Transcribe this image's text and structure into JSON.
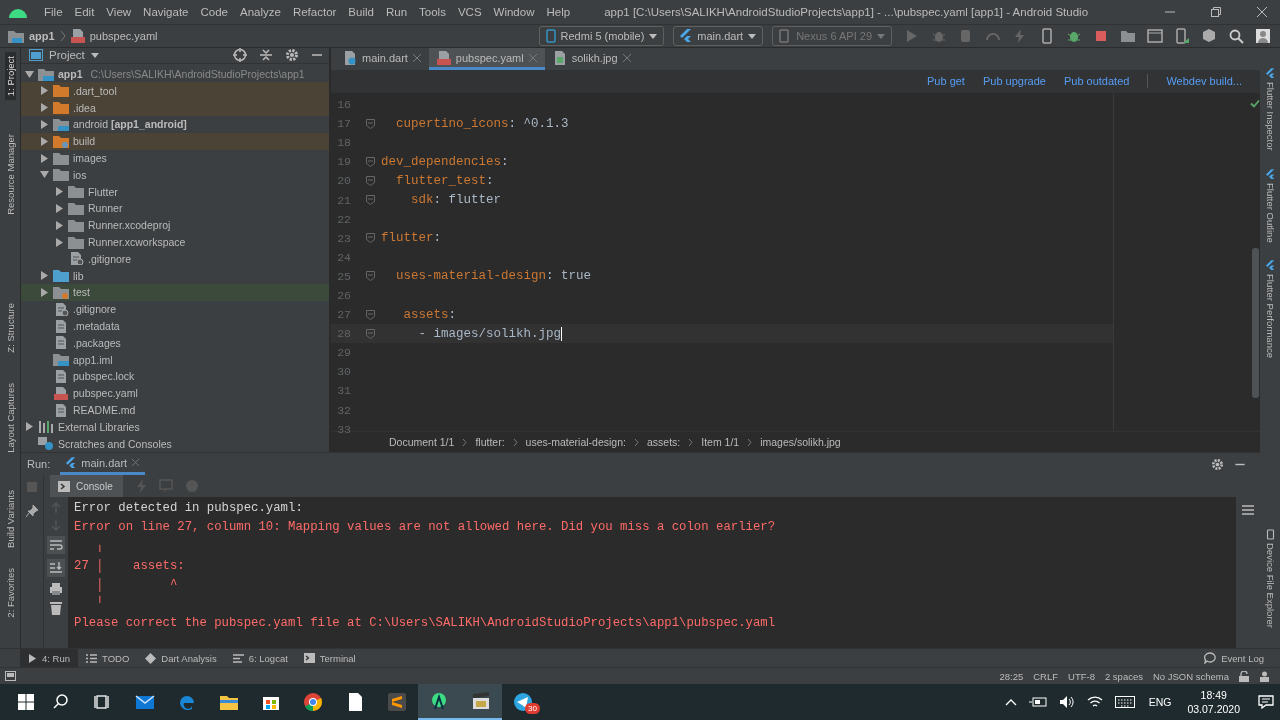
{
  "menu_bar": {
    "items": [
      "File",
      "Edit",
      "View",
      "Navigate",
      "Code",
      "Analyze",
      "Refactor",
      "Build",
      "Run",
      "Tools",
      "VCS",
      "Window",
      "Help"
    ],
    "title": "app1 [C:\\Users\\SALIKH\\AndroidStudioProjects\\app1] - ...\\pubspec.yaml [app1] - Android Studio"
  },
  "nav_bar": {
    "breadcrumb": [
      "app1",
      "pubspec.yaml"
    ],
    "device": "Redmi 5 (mobile)",
    "run_config": "main.dart",
    "emulator": {
      "label": "Nexus 6 API 29",
      "disabled": true
    }
  },
  "left_strip": [
    {
      "label": "1: Project",
      "selected": true
    },
    {
      "label": "Resource Manager",
      "selected": false
    },
    {
      "label": "Z: Structure",
      "selected": false
    },
    {
      "label": "Layout Captures",
      "selected": false
    },
    {
      "label": "Build Variants",
      "selected": false
    },
    {
      "label": "2: Favorites",
      "selected": false
    }
  ],
  "right_strip": [
    "Flutter Inspector",
    "Flutter Outline",
    "Flutter Performance",
    "Device File Explorer"
  ],
  "project": {
    "title": "Project",
    "tree": [
      {
        "name": "app1",
        "path": "C:\\Users\\SALIKH\\AndroidStudioProjects\\app1",
        "kind": "module",
        "expanded": true,
        "children": [
          {
            "name": ".dart_tool",
            "kind": "excluded",
            "expanded": false,
            "color": "#4b4336"
          },
          {
            "name": ".idea",
            "kind": "excluded",
            "expanded": false,
            "color": "#4b4336"
          },
          {
            "name": "android **[app1_android]**",
            "kind": "module",
            "expanded": false
          },
          {
            "name": "build",
            "kind": "build",
            "expanded": false,
            "color": "#4b4336"
          },
          {
            "name": "images",
            "kind": "folder",
            "expanded": false
          },
          {
            "name": "ios",
            "kind": "folder",
            "expanded": true,
            "children": [
              {
                "name": "Flutter",
                "kind": "folder",
                "expanded": false
              },
              {
                "name": "Runner",
                "kind": "folder",
                "expanded": false
              },
              {
                "name": "Runner.xcodeproj",
                "kind": "folder",
                "expanded": false
              },
              {
                "name": "Runner.xcworkspace",
                "kind": "folder",
                "expanded": false
              },
              {
                "name": ".gitignore",
                "kind": "ignore"
              }
            ]
          },
          {
            "name": "lib",
            "kind": "source",
            "expanded": false
          },
          {
            "name": "test",
            "kind": "test",
            "expanded": false,
            "color": "#3c4a3b"
          },
          {
            "name": ".gitignore",
            "kind": "ignore"
          },
          {
            "name": ".metadata",
            "kind": "file"
          },
          {
            "name": ".packages",
            "kind": "file"
          },
          {
            "name": "app1.iml",
            "kind": "module"
          },
          {
            "name": "pubspec.lock",
            "kind": "file"
          },
          {
            "name": "pubspec.yaml",
            "kind": "yaml"
          },
          {
            "name": "README.md",
            "kind": "file"
          }
        ]
      },
      {
        "name": "External Libraries",
        "kind": "libraries",
        "expanded": false
      },
      {
        "name": "Scratches and Consoles",
        "kind": "scratches"
      }
    ]
  },
  "editor": {
    "tabs": [
      {
        "label": "main.dart",
        "kind": "dart",
        "selected": false
      },
      {
        "label": "pubspec.yaml",
        "kind": "yaml",
        "selected": true
      },
      {
        "label": "solikh.jpg",
        "kind": "image",
        "selected": false
      }
    ],
    "actions": [
      "Pub get",
      "Pub upgrade",
      "Pub outdated",
      "Webdev build..."
    ],
    "lines": [
      {
        "number": "16"
      },
      {
        "number": "17",
        "fold": true,
        "current": false,
        "segments": [
          {
            "kind": "key",
            "text": "  cupertino_icons"
          },
          {
            "kind": "plain",
            "text": ": ^0.1.3"
          }
        ]
      },
      {
        "number": "18"
      },
      {
        "number": "19",
        "fold": true,
        "current": false,
        "segments": [
          {
            "kind": "key",
            "text": "dev_dependencies"
          },
          {
            "kind": "plain",
            "text": ":"
          }
        ]
      },
      {
        "number": "20",
        "fold": true,
        "current": false,
        "segments": [
          {
            "kind": "key",
            "text": "  flutter_test"
          },
          {
            "kind": "plain",
            "text": ":"
          }
        ]
      },
      {
        "number": "21",
        "fold": true,
        "current": false,
        "segments": [
          {
            "kind": "key",
            "text": "    sdk"
          },
          {
            "kind": "plain",
            "text": ": flutter"
          }
        ]
      },
      {
        "number": "22"
      },
      {
        "number": "23",
        "fold": true,
        "current": false,
        "segments": [
          {
            "kind": "key",
            "text": "flutter"
          },
          {
            "kind": "plain",
            "text": ":"
          }
        ]
      },
      {
        "number": "24"
      },
      {
        "number": "25",
        "fold": true,
        "current": false,
        "segments": [
          {
            "kind": "key",
            "text": "  uses-material-design"
          },
          {
            "kind": "plain",
            "text": ": true"
          }
        ]
      },
      {
        "number": "26"
      },
      {
        "number": "27",
        "fold": true,
        "current": false,
        "segments": [
          {
            "kind": "key",
            "text": "   assets"
          },
          {
            "kind": "plain",
            "text": ":"
          }
        ]
      },
      {
        "number": "28",
        "fold": true,
        "current": true,
        "segments": [
          {
            "kind": "plain",
            "text": "     - images/solikh.jpg"
          }
        ]
      },
      {
        "number": "29"
      },
      {
        "number": "30"
      },
      {
        "number": "31"
      },
      {
        "number": "32"
      },
      {
        "number": "33"
      }
    ],
    "breadcrumb": [
      "Document 1/1",
      "flutter:",
      "uses-material-design:",
      "assets:",
      "Item 1/1",
      "images/solikh.jpg"
    ]
  },
  "run_panel": {
    "label": "Run:",
    "tab": "main.dart",
    "console_tab": "Console",
    "output": [
      {
        "kind": "plain",
        "text": "Error detected in pubspec.yaml:"
      },
      {
        "kind": "error",
        "text": "Error on line 27, column 10: Mapping values are not allowed here. Did you miss a colon earlier?"
      },
      {
        "kind": "error",
        "text": "   ╷"
      },
      {
        "kind": "error",
        "text": "27 │    assets:"
      },
      {
        "kind": "error",
        "text": "   │         ^"
      },
      {
        "kind": "error",
        "text": "   ╵"
      },
      {
        "kind": "error",
        "text": "Please correct the pubspec.yaml file at C:\\Users\\SALIKH\\AndroidStudioProjects\\app1\\pubspec.yaml"
      }
    ]
  },
  "tool_tabs": [
    {
      "label": "4: Run",
      "kind": "run",
      "selected": true
    },
    {
      "label": "TODO",
      "kind": "list",
      "selected": false
    },
    {
      "label": "Dart Analysis",
      "kind": "dart",
      "selected": false
    },
    {
      "label": "6: Logcat",
      "kind": "logcat",
      "selected": false
    },
    {
      "label": "Terminal",
      "kind": "terminal",
      "selected": false
    }
  ],
  "event_log": "Event Log",
  "status_bar": [
    "28:25",
    "CRLF",
    "UTF-8",
    "2 spaces",
    "No JSON schema"
  ],
  "taskbar": {
    "apps": [
      {
        "kind": "search",
        "active": false
      },
      {
        "kind": "taskview",
        "active": false
      },
      {
        "kind": "mail",
        "active": false
      },
      {
        "kind": "edge",
        "active": false
      },
      {
        "kind": "explorer",
        "active": false
      },
      {
        "kind": "store",
        "active": false
      },
      {
        "kind": "chrome",
        "active": false
      },
      {
        "kind": "file",
        "active": false
      },
      {
        "kind": "sublime",
        "active": false
      },
      {
        "kind": "studio",
        "active": true
      },
      {
        "kind": "clapper",
        "active": true
      },
      {
        "kind": "telegram",
        "active": false,
        "badge": "30"
      }
    ],
    "language": "ENG",
    "time": "18:49",
    "date": "03.07.2020"
  }
}
